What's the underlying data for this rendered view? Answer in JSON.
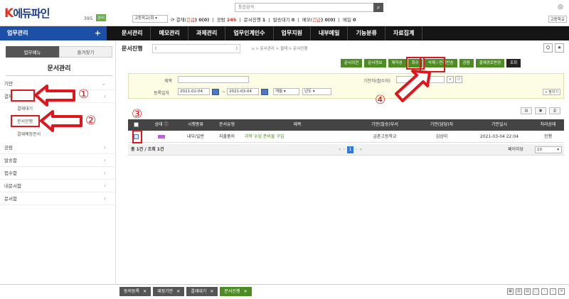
{
  "header": {
    "logo_mark": "K",
    "logo_text": "에듀파인",
    "user_id": "39도",
    "user_badge": "관리",
    "school_select": "고등학교(회 ▾",
    "search_placeholder": "통합검색",
    "search_icon": "search-icon",
    "status": {
      "approve_label": "결재(",
      "approve_urgent": "긴급",
      "approve_count": ") 0(0)",
      "public_label": "공람",
      "public_count": "245",
      "progress_label": "문서진행",
      "progress_count": "1",
      "send_label": "발송대기",
      "send_count": "0",
      "memo_label": "메모(",
      "memo_urgent": "긴급",
      "memo_count": ") 0(0)",
      "mail_label": "메일",
      "mail_count": "0"
    },
    "school_right": "고등학교"
  },
  "nav": {
    "main_menu": "업무관리",
    "plus": "+",
    "items": [
      "문서관리",
      "메모관리",
      "과제관리",
      "업무인계인수",
      "업무지원",
      "내부메일",
      "기능분류",
      "자료집계"
    ]
  },
  "sidebar": {
    "tabs": [
      "업무메뉴",
      "즐겨찾기"
    ],
    "title": "문서관리",
    "items": [
      {
        "label": "기안",
        "chev": "⌄"
      },
      {
        "label": "결재",
        "chev": "›"
      },
      {
        "label": "결재대기"
      },
      {
        "label": "문서진행"
      },
      {
        "label": "결재예정문서"
      },
      {
        "label": "공람",
        "chev": "›"
      },
      {
        "label": "발송함",
        "chev": "›"
      },
      {
        "label": "접수함",
        "chev": "›"
      },
      {
        "label": "내문서함",
        "chev": "›"
      },
      {
        "label": "문서함",
        "chev": "›"
      }
    ]
  },
  "main": {
    "title": "문서진행",
    "title_meta": "(",
    "title_meta_end": ")",
    "breadcrumb": "⌂  >  문서관리 > 결재 > 문서진행",
    "help": "Q",
    "star": "★",
    "actions": [
      "문서의견",
      "문서정보",
      "재작성",
      "회수",
      "삭제 / 연계반송",
      "공람",
      "결재경로변경",
      "조회"
    ],
    "filter": {
      "title_label": "제목",
      "drafter_label": "기안자(접수자)",
      "date_label": "등록일자",
      "date_from": "2021-02-04",
      "date_to": "2021-03-04",
      "sep": "~",
      "period": "개월 ▾",
      "year": "년도 ▾",
      "detail": "∨ 펼치기"
    },
    "table": {
      "headers": [
        "",
        "상태",
        "시행종류",
        "문서유형",
        "제목",
        "기안(발송)부서",
        "기안(담당)자",
        "기안일시",
        "처리상태"
      ],
      "rows": [
        {
          "status": "",
          "type": "내부/일반",
          "doc_type": "지출품의",
          "title": "과학 수업 준비물 구입",
          "dept": "금촌고등학교",
          "drafter": "김상미",
          "date": "2021-03-04 22:04",
          "state": "진행"
        }
      ],
      "total": "총 1건 / 조회 1건",
      "pager": [
        "«",
        "‹",
        "1",
        "›",
        "»"
      ],
      "per_page_label": "페이지당",
      "per_page_value": "10"
    }
  },
  "bottom_tabs": [
    {
      "label": "동의등록"
    },
    {
      "label": "재정기안"
    },
    {
      "label": "결재대기"
    },
    {
      "label": "문서진행",
      "active": true
    }
  ],
  "annotations": [
    "①",
    "②",
    "③",
    "④"
  ],
  "colors": {
    "nav_bg": "#151515",
    "nav_accent": "#1c4fa6",
    "action_green": "#4c8c23",
    "annotation_red": "#e0161c",
    "table_head": "#444444"
  }
}
